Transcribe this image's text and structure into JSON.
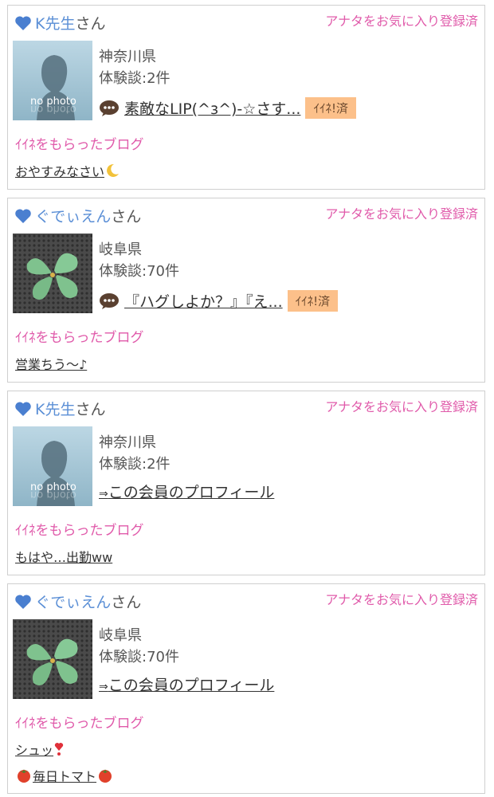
{
  "cards": [
    {
      "name": "K先生",
      "san": "さん",
      "fav_status": "アナタをお気に入り登録済",
      "prefecture": "神奈川県",
      "experience": "体験談:2件",
      "comment": "素敵なLIP(^з^)-☆さす...",
      "iine_label": "ｲｲﾈ!済",
      "blog_label": "ｲｲﾈをもらったブログ",
      "blog_titles": [
        "おやすみなさい"
      ],
      "thumb_text": "no photo",
      "thumb_text_reflect": "no photo"
    },
    {
      "name": "ぐでぃえん",
      "san": "さん",
      "fav_status": "アナタをお気に入り登録済",
      "prefecture": "岐阜県",
      "experience": "体験談:70件",
      "comment": "『ハグしよか？』『え...",
      "iine_label": "ｲｲﾈ!済",
      "blog_label": "ｲｲﾈをもらったブログ",
      "blog_titles": [
        "営業ちう～♪"
      ]
    },
    {
      "name": "K先生",
      "san": "さん",
      "fav_status": "アナタをお気に入り登録済",
      "prefecture": "神奈川県",
      "experience": "体験談:2件",
      "profile_link": "この会員のプロフィール",
      "arrow": "⇒",
      "blog_label": "ｲｲﾈをもらったブログ",
      "blog_titles": [
        "もはや…出勤ww"
      ],
      "thumb_text": "no photo",
      "thumb_text_reflect": "no photo"
    },
    {
      "name": "ぐでぃえん",
      "san": "さん",
      "fav_status": "アナタをお気に入り登録済",
      "prefecture": "岐阜県",
      "experience": "体験談:70件",
      "profile_link": "この会員のプロフィール",
      "arrow": "⇒",
      "blog_label": "ｲｲﾈをもらったブログ",
      "blog_titles": [
        "シュッ",
        "毎日トマト"
      ]
    }
  ],
  "colors": {
    "user_name": "#5b8fd6",
    "pink": "#e05aaa",
    "iine_bg": "#fcc08a",
    "heart": "#4a7fd0"
  }
}
